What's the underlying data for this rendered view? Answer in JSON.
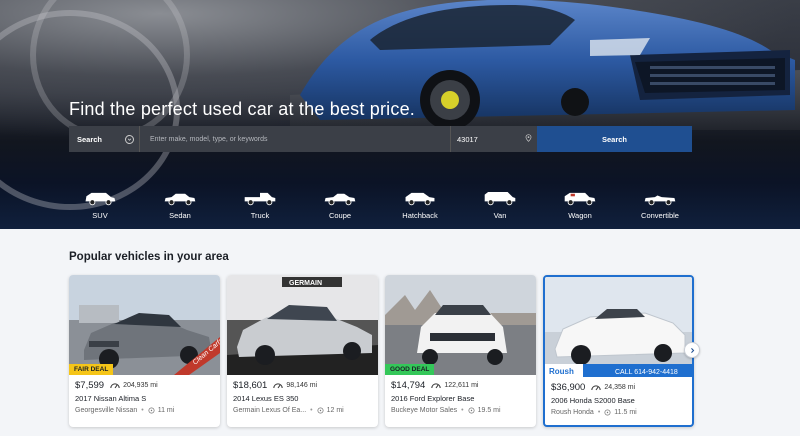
{
  "hero": {
    "title": "Find the perfect used car at the best price."
  },
  "search": {
    "type_label": "Search",
    "input_placeholder": "Enter make, model, type, or keywords",
    "zip": "43017",
    "button_label": "Search"
  },
  "body_types": [
    {
      "label": "SUV",
      "icon": "suv-icon"
    },
    {
      "label": "Sedan",
      "icon": "sedan-icon"
    },
    {
      "label": "Truck",
      "icon": "truck-icon"
    },
    {
      "label": "Coupe",
      "icon": "coupe-icon"
    },
    {
      "label": "Hatchback",
      "icon": "hatchback-icon"
    },
    {
      "label": "Van",
      "icon": "van-icon"
    },
    {
      "label": "Wagon",
      "icon": "wagon-icon"
    },
    {
      "label": "Convertible",
      "icon": "convertible-icon"
    }
  ],
  "popular": {
    "title": "Popular vehicles in your area",
    "cards": [
      {
        "deal": "FAIR DEAL",
        "price": "$7,599",
        "mileage": "204,935 mi",
        "title": "2017 Nissan Altima S",
        "dealer": "Georgesville Nissan",
        "distance": "11 mi",
        "car_color": "#6f747b",
        "badge": "Clean Carfax"
      },
      {
        "deal": "",
        "price": "$18,601",
        "mileage": "98,146 mi",
        "title": "2014 Lexus ES 350",
        "dealer": "Germain Lexus Of Ea...",
        "distance": "12 mi",
        "car_color": "#c9ccd0",
        "dealer_sign": "GERMAIN"
      },
      {
        "deal": "GOOD DEAL",
        "price": "$14,794",
        "mileage": "122,611 mi",
        "title": "2016 Ford Explorer Base",
        "dealer": "Buckeye Motor Sales",
        "distance": "19.5 mi",
        "car_color": "#f2f2f2"
      },
      {
        "deal": "",
        "price": "$36,900",
        "mileage": "24,358 mi",
        "title": "2006 Honda S2000 Base",
        "dealer": "Roush Honda",
        "distance": "11.5 mi",
        "car_color": "#f7f7f7",
        "banner": "CALL 614-942-4418",
        "brand": "Roush"
      }
    ]
  },
  "colors": {
    "primary_button": "#1f4f91",
    "fair_deal": "#f5c518",
    "good_deal": "#34c759"
  }
}
